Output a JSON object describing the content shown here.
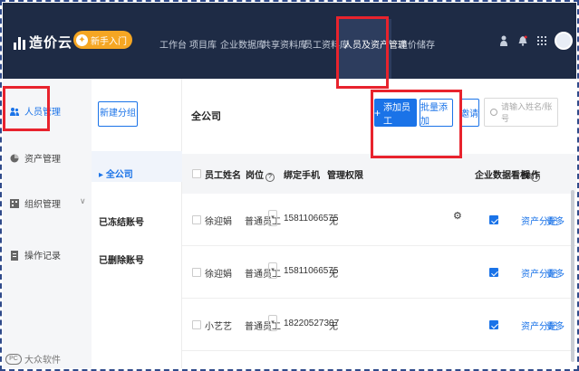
{
  "app": {
    "logo_text": "造价云",
    "beginner_badge": "新手入门",
    "nav": [
      {
        "label": "工作台"
      },
      {
        "label": "项目库"
      },
      {
        "label": "企业数据库"
      },
      {
        "label": "共享资料库"
      },
      {
        "label": "员工资料库"
      },
      {
        "label": "人员及资产管理",
        "active": true
      },
      {
        "label": "造价储存"
      }
    ],
    "top_icons": [
      "person-icon",
      "bell-icon",
      "grid-icon",
      "avatar"
    ]
  },
  "sidebar": {
    "items": [
      {
        "label": "人员管理",
        "icon": "people-icon",
        "active": true
      },
      {
        "label": "资产管理",
        "icon": "asset-icon"
      },
      {
        "label": "组织管理",
        "icon": "org-icon",
        "has_chevron": true
      },
      {
        "label": "操作记录",
        "icon": "log-icon"
      }
    ]
  },
  "midpanel": {
    "new_branch": "新建分组",
    "items": [
      {
        "label": "全公司",
        "active": true
      },
      {
        "label": "已冻结账号"
      },
      {
        "label": "已删除账号"
      }
    ]
  },
  "main": {
    "title": "全公司",
    "add_employee": "添加员工",
    "batch_add": "批量添加",
    "invite": "邀请",
    "search_placeholder": "请输入姓名/账号",
    "columns": {
      "name": "员工姓名",
      "position": "岗位",
      "phone": "绑定手机",
      "permission": "管理权限",
      "dashboard": "企业数据看板",
      "actions": "操作"
    },
    "rows": [
      {
        "name": "徐迎娟",
        "position": "普通员工",
        "phone": "15811066575",
        "permission": "无",
        "dashboard_checked": true,
        "has_gear": true,
        "action_1": "资产分配",
        "action_2": "更多"
      },
      {
        "name": "徐迎娟",
        "position": "普通员工",
        "phone": "15811066575",
        "permission": "无",
        "dashboard_checked": true,
        "has_gear": false,
        "action_1": "资产分配",
        "action_2": "更多"
      },
      {
        "name": "小艺艺",
        "position": "普通员工",
        "phone": "18220527307",
        "permission": "无",
        "dashboard_checked": true,
        "has_gear": false,
        "action_1": "资产分配",
        "action_2": "更多"
      }
    ]
  },
  "watermark": "大众软件"
}
